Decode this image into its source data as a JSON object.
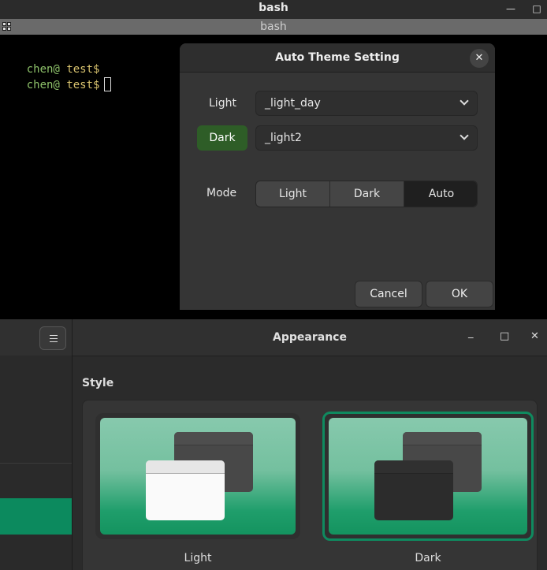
{
  "terminal": {
    "window_title": "bash",
    "tab_title": "bash",
    "minimize_glyph": "—",
    "maximize_glyph": "□",
    "lines": [
      {
        "user": "chen@",
        "path": "test$"
      },
      {
        "user": "chen@",
        "path": "test$"
      }
    ]
  },
  "dialog": {
    "title": "Auto Theme Setting",
    "close_glyph": "✕",
    "light_label": "Light",
    "light_value": "_light_day",
    "dark_label": "Dark",
    "dark_value": "_light2",
    "mode_label": "Mode",
    "mode_options": [
      "Light",
      "Dark",
      "Auto"
    ],
    "mode_selected": "Auto",
    "cancel_label": "Cancel",
    "ok_label": "OK"
  },
  "appearance": {
    "title": "Appearance",
    "minimize_glyph": "_",
    "maximize_glyph": "□",
    "close_glyph": "✕",
    "style_label": "Style",
    "styles": [
      {
        "label": "Light",
        "selected": false
      },
      {
        "label": "Dark",
        "selected": true
      }
    ],
    "accent_color": "#0c8a5e"
  }
}
